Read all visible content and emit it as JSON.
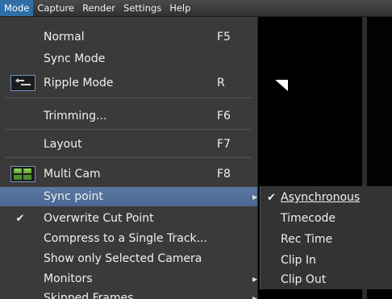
{
  "menubar": {
    "items": [
      "Mode",
      "Capture",
      "Render",
      "Settings",
      "Help"
    ]
  },
  "mode_menu": {
    "items": [
      {
        "label": "Normal",
        "shortcut": "F5"
      },
      {
        "label": "Sync Mode",
        "shortcut": ""
      },
      {
        "label": "Ripple Mode",
        "shortcut": "R",
        "icon": "ripple-mode-icon"
      },
      {
        "label": "Trimming...",
        "shortcut": "F6"
      },
      {
        "label": "Layout",
        "shortcut": "F7"
      },
      {
        "label": "Multi Cam",
        "shortcut": "F8",
        "icon": "multi-cam-icon"
      },
      {
        "label": "Sync point",
        "shortcut": "",
        "submenu": true
      },
      {
        "label": "Overwrite Cut Point",
        "shortcut": "",
        "checked": true
      },
      {
        "label": "Compress to a Single Track...",
        "shortcut": ""
      },
      {
        "label": "Show only Selected Camera",
        "shortcut": ""
      },
      {
        "label": "Monitors",
        "shortcut": "",
        "submenu": true
      },
      {
        "label": "Skipped Frames",
        "shortcut": "",
        "submenu": true
      }
    ]
  },
  "sync_point_submenu": {
    "items": [
      {
        "label": "Asynchronous",
        "checked": true
      },
      {
        "label": "Timecode"
      },
      {
        "label": "Rec Time"
      },
      {
        "label": "Clip In"
      },
      {
        "label": "Clip Out"
      }
    ]
  },
  "glyphs": {
    "check": "✔",
    "arrow": "▶"
  },
  "colors": {
    "menu_bg": "#3a3a3a",
    "highlight": "#5a78a4",
    "menubar_active": "#2f6ea7"
  }
}
